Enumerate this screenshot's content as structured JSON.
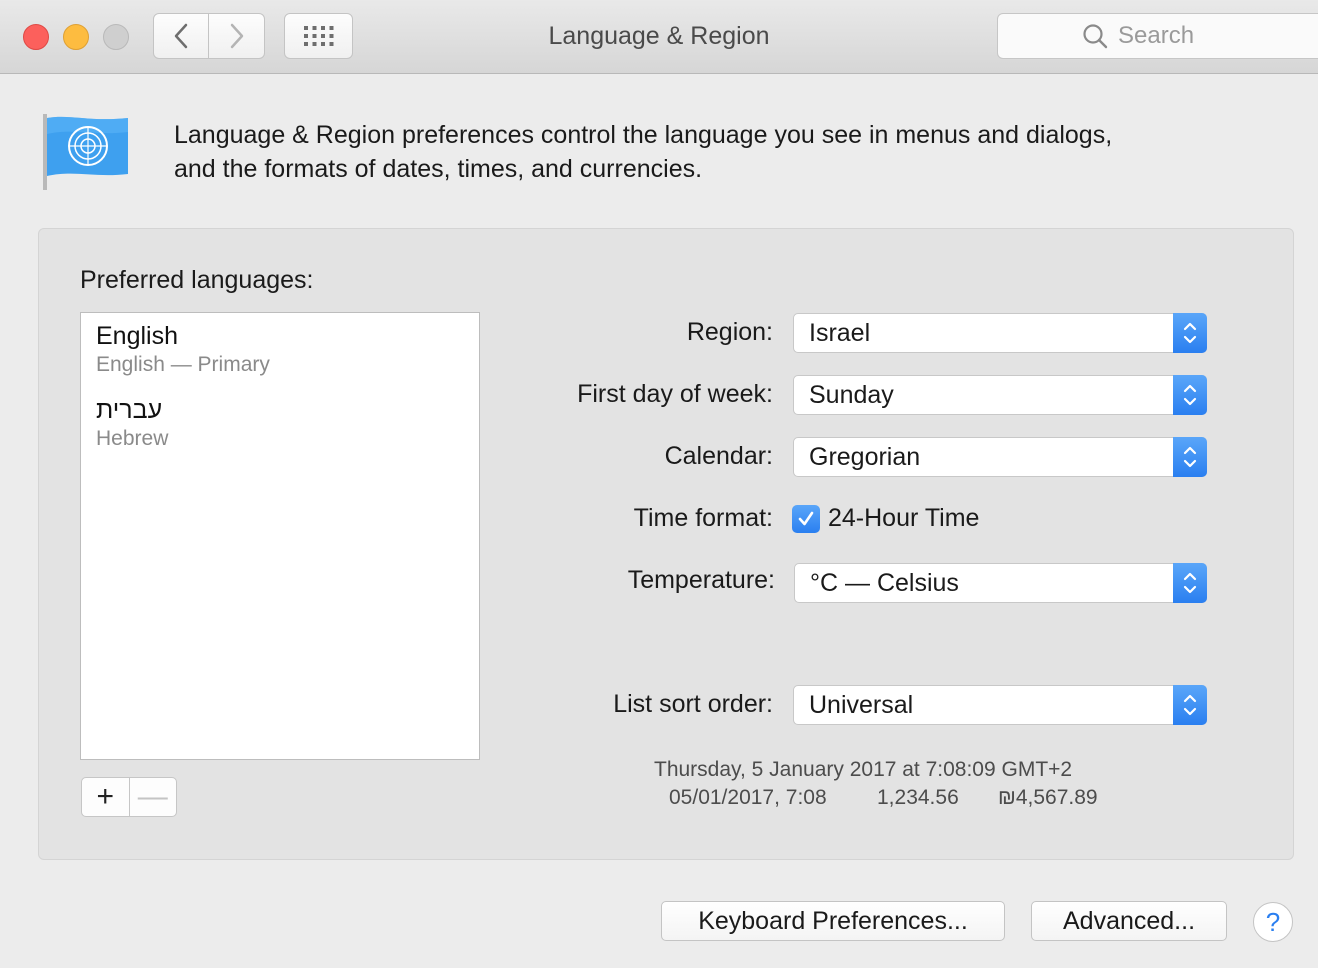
{
  "window": {
    "title": "Language & Region",
    "search_placeholder": "Search",
    "icons": [
      "close-button",
      "minimize-button",
      "zoom-button",
      "chevron-left-icon",
      "chevron-right-icon",
      "grid-icon",
      "search-icon"
    ]
  },
  "intro": {
    "line1": "Language & Region preferences control the language you see in menus and dialogs,",
    "line2": "and the formats of dates, times, and currencies."
  },
  "languages": {
    "label": "Preferred languages:",
    "items": [
      {
        "name": "English",
        "sub": "English — Primary"
      },
      {
        "name": "עברית",
        "sub": "Hebrew"
      }
    ],
    "add_label": "+",
    "remove_label": "—"
  },
  "settings": {
    "region": {
      "label": "Region:",
      "value": "Israel"
    },
    "first_day": {
      "label": "First day of week:",
      "value": "Sunday"
    },
    "calendar": {
      "label": "Calendar:",
      "value": "Gregorian"
    },
    "time_format": {
      "label": "Time format:",
      "checkbox_label": "24-Hour Time",
      "checked": true
    },
    "temperature": {
      "label": "Temperature:",
      "value": "°C — Celsius"
    },
    "sort_order": {
      "label": "List sort order:",
      "value": "Universal"
    }
  },
  "sample": {
    "date_long": "Thursday, 5 January 2017 at 7:08:09 GMT+2",
    "date_short": "05/01/2017, 7:08",
    "number": "1,234.56",
    "currency": "₪4,567.89"
  },
  "buttons": {
    "keyboard": "Keyboard Preferences...",
    "advanced": "Advanced...",
    "help": "?"
  },
  "colors": {
    "accent": "#2a7ff0",
    "close": "#fc605c",
    "minimize": "#fdbc40"
  }
}
